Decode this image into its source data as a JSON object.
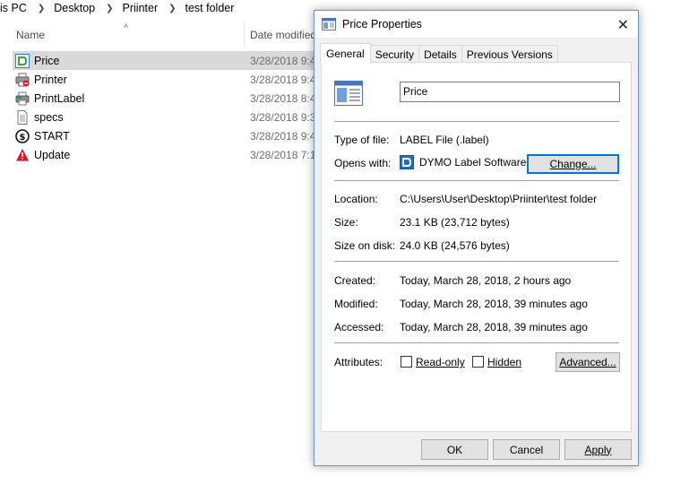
{
  "explorer": {
    "breadcrumb": [
      "is PC",
      "Desktop",
      "Priinter",
      "test folder"
    ],
    "columns": {
      "name": "Name",
      "date_modified": "Date modified"
    },
    "files": [
      {
        "name": "Price",
        "date": "3/28/2018 9:4",
        "icon": "dymo-label-icon",
        "selected": true
      },
      {
        "name": "Printer",
        "date": "3/28/2018 9:4",
        "icon": "printer-icon",
        "selected": false
      },
      {
        "name": "PrintLabel",
        "date": "3/28/2018 8:4",
        "icon": "printlabel-icon",
        "selected": false
      },
      {
        "name": "specs",
        "date": "3/28/2018 9:3",
        "icon": "text-document-icon",
        "selected": false
      },
      {
        "name": "START",
        "date": "3/28/2018 9:4",
        "icon": "dollar-circle-icon",
        "selected": false
      },
      {
        "name": "Update",
        "date": "3/28/2018 7:1",
        "icon": "warning-icon",
        "selected": false
      }
    ]
  },
  "dialog": {
    "title": "Price Properties",
    "close_glyph": "✕",
    "tabs": [
      "General",
      "Security",
      "Details",
      "Previous Versions"
    ],
    "active_tab": "General",
    "file_name": "Price",
    "type_label": "Type of file:",
    "type_value": "LABEL File (.label)",
    "opens_label": "Opens with:",
    "opens_value": "DYMO Label Software",
    "change_button": "Change...",
    "location_label": "Location:",
    "location_value": "C:\\Users\\User\\Desktop\\Priinter\\test folder",
    "size_label": "Size:",
    "size_value": "23.1 KB (23,712 bytes)",
    "size_disk_label": "Size on disk:",
    "size_disk_value": "24.0 KB (24,576 bytes)",
    "created_label": "Created:",
    "created_value": "Today, March 28, 2018, 2 hours ago",
    "modified_label": "Modified:",
    "modified_value": "Today, March 28, 2018, 39 minutes ago",
    "accessed_label": "Accessed:",
    "accessed_value": "Today, March 28, 2018, 39 minutes ago",
    "attributes_label": "Attributes:",
    "readonly_label": "Read-only",
    "hidden_label": "Hidden",
    "advanced_button": "Advanced...",
    "ok_button": "OK",
    "cancel_button": "Cancel",
    "apply_button": "Apply"
  },
  "colors": {
    "selection": "#d9d9d9",
    "dialog_border": "#6b93c7",
    "focus_blue": "#0078d7",
    "warning_red": "#e81123"
  }
}
